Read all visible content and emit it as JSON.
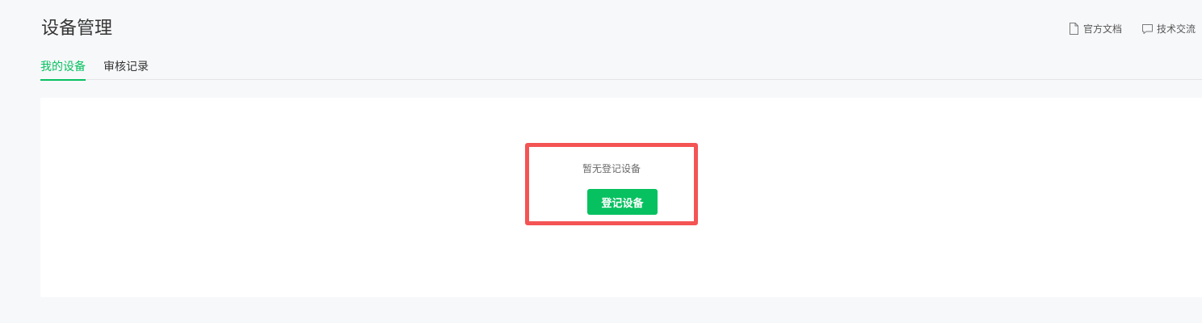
{
  "header": {
    "title": "设备管理",
    "links": [
      {
        "label": "官方文档",
        "icon": "document-icon"
      },
      {
        "label": "技术交流",
        "icon": "chat-bubble-icon"
      }
    ]
  },
  "tabs": [
    {
      "label": "我的设备",
      "active": true
    },
    {
      "label": "审核记录",
      "active": false
    }
  ],
  "main": {
    "empty_message": "暂无登记设备",
    "register_button_label": "登记设备"
  },
  "colors": {
    "accent": "#07c160",
    "highlight": "#f45454",
    "background": "#f7f8fa",
    "panel": "#ffffff"
  }
}
